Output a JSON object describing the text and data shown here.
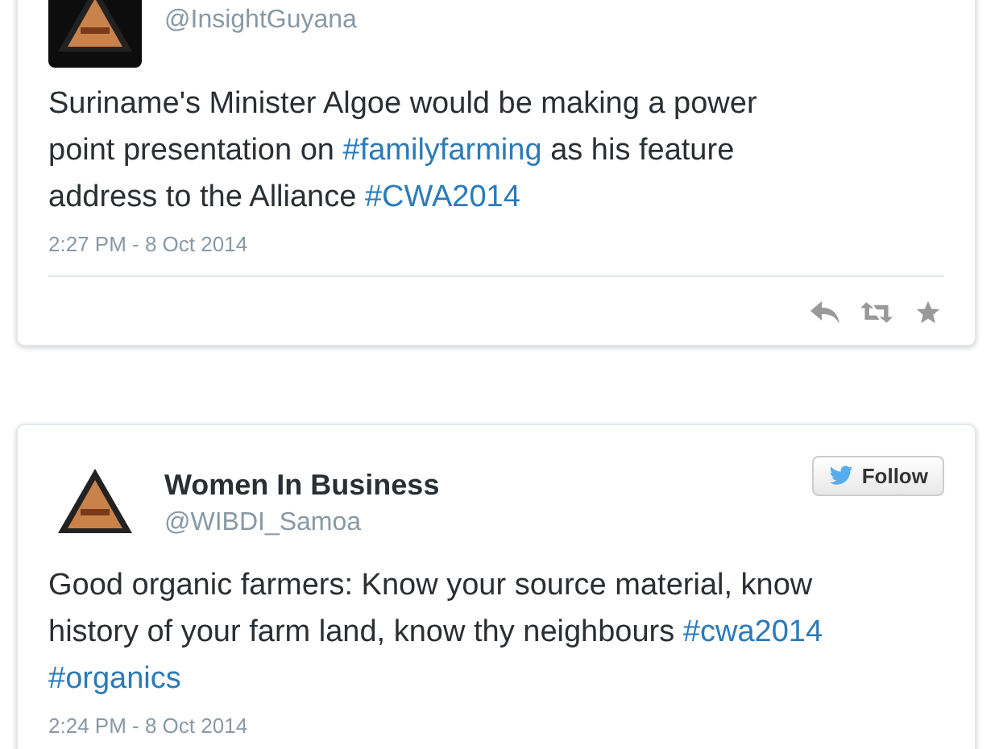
{
  "tweets": [
    {
      "handle": "@InsightGuyana",
      "avatar": {
        "kind": "picture"
      },
      "text": [
        {
          "kind": "text",
          "s": "Suriname's Minister Algoe would be making a power point presentation on "
        },
        {
          "kind": "hashtag",
          "s": "#familyfarming"
        },
        {
          "kind": "text",
          "s": " as his feature address to the Alliance "
        },
        {
          "kind": "hashtag",
          "s": "#CWA2014"
        }
      ],
      "time": "2:27 PM - 8 Oct 2014"
    },
    {
      "name": "Women In Business",
      "handle": "@WIBDI_Samoa",
      "avatar": {
        "kind": "picture"
      },
      "follow": "Follow",
      "text": [
        {
          "kind": "text",
          "s": "Good organic farmers: Know your source material, know history of your farm land, know thy neighbours "
        },
        {
          "kind": "hashtag",
          "s": "#cwa2014"
        },
        {
          "kind": "hashtag",
          "s": "#organics"
        }
      ],
      "time": "2:24 PM - 8 Oct 2014"
    }
  ]
}
